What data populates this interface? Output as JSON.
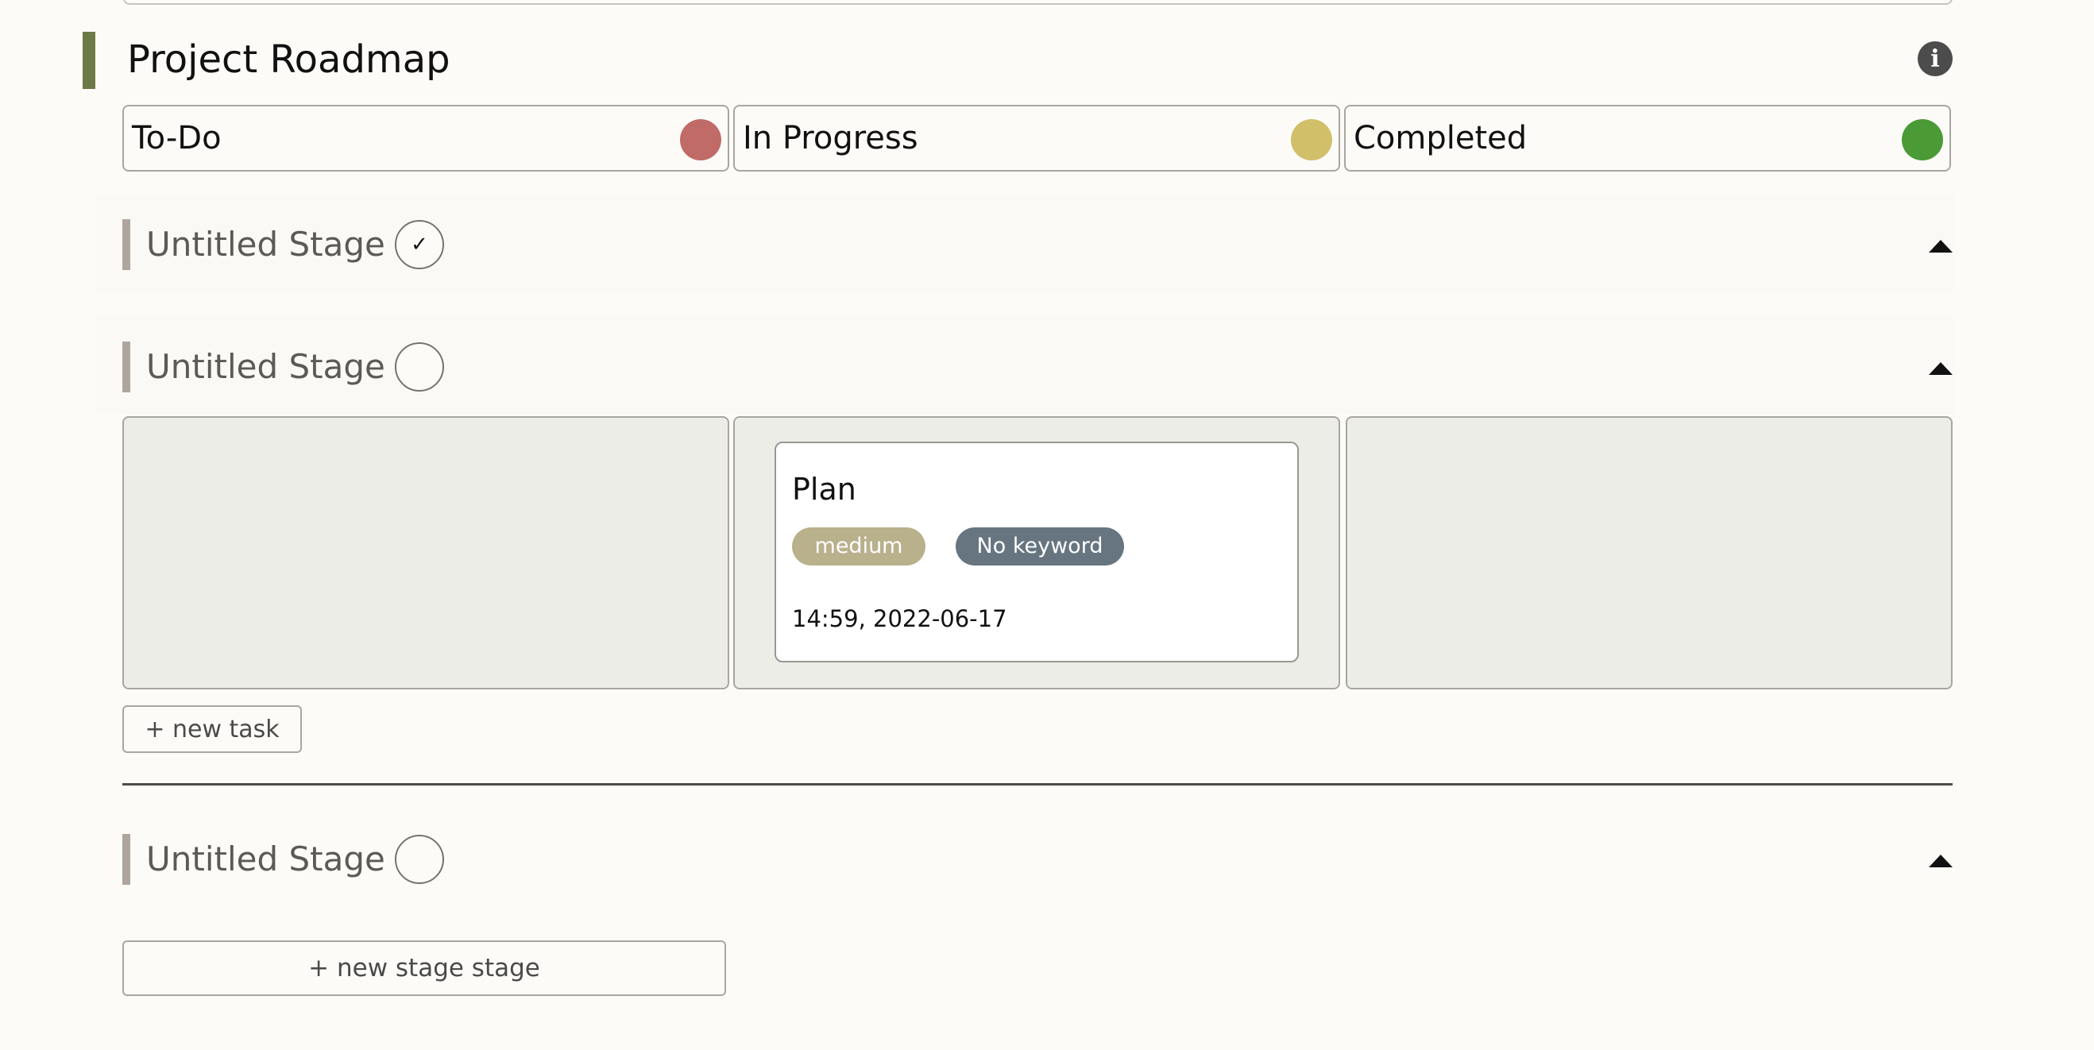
{
  "board": {
    "title": "Project Roadmap",
    "info_icon": "info-icon"
  },
  "statuses": [
    {
      "label": "To-Do",
      "color": "#c06b68"
    },
    {
      "label": "In Progress",
      "color": "#d2bf6a"
    },
    {
      "label": "Completed",
      "color": "#4a9a36"
    }
  ],
  "stages": [
    {
      "title": "Untitled Stage",
      "check": "✓",
      "collapse_icon": "chevron-up-icon"
    },
    {
      "title": "Untitled Stage",
      "check": "",
      "collapse_icon": "chevron-up-icon"
    },
    {
      "title": "Untitled Stage",
      "check": "",
      "collapse_icon": "chevron-up-icon"
    }
  ],
  "task": {
    "title": "Plan",
    "priority": "medium",
    "keyword": "No keyword",
    "timestamp": "14:59, 2022-06-17"
  },
  "actions": {
    "new_task": "+ new task",
    "new_stage": "+ new stage stage"
  }
}
